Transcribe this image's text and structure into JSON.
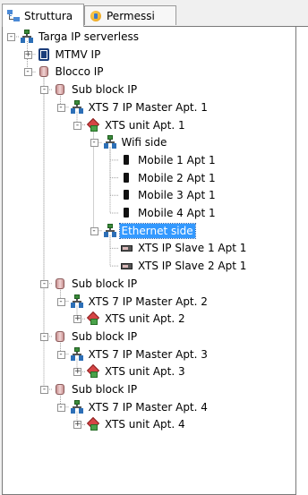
{
  "tabs": [
    {
      "label": "Struttura",
      "icon": "structure-icon",
      "active": true
    },
    {
      "label": "Permessi",
      "icon": "permissions-icon",
      "active": false
    }
  ],
  "tree": {
    "selected_color": "#3399ff",
    "nodes": [
      {
        "label": "Targa IP serverless",
        "icon": "network-icon",
        "level": 0,
        "toggle": "-"
      },
      {
        "label": "MTMV IP",
        "icon": "mtmv-icon",
        "level": 1,
        "toggle": "+"
      },
      {
        "label": "Blocco IP",
        "icon": "block-icon",
        "level": 1,
        "toggle": "-"
      },
      {
        "label": "Sub block IP",
        "icon": "block-icon",
        "level": 2,
        "toggle": "-"
      },
      {
        "label": "XTS 7 IP Master Apt. 1",
        "icon": "network-icon",
        "level": 3,
        "toggle": "-"
      },
      {
        "label": "XTS unit Apt. 1",
        "icon": "unit-icon",
        "level": 4,
        "toggle": "-"
      },
      {
        "label": "Wifi side",
        "icon": "network-icon",
        "level": 5,
        "toggle": "-"
      },
      {
        "label": "Mobile 1 Apt 1",
        "icon": "mobile-icon",
        "level": 6,
        "toggle": ""
      },
      {
        "label": "Mobile 2 Apt 1",
        "icon": "mobile-icon",
        "level": 6,
        "toggle": ""
      },
      {
        "label": "Mobile 3 Apt 1",
        "icon": "mobile-icon",
        "level": 6,
        "toggle": ""
      },
      {
        "label": "Mobile 4 Apt 1",
        "icon": "mobile-icon",
        "level": 6,
        "toggle": ""
      },
      {
        "label": "Ethernet side",
        "icon": "network-icon",
        "level": 5,
        "toggle": "-",
        "selected": true
      },
      {
        "label": "XTS IP Slave 1 Apt 1",
        "icon": "slave-icon",
        "level": 6,
        "toggle": ""
      },
      {
        "label": "XTS IP Slave 2 Apt 1",
        "icon": "slave-icon",
        "level": 6,
        "toggle": ""
      },
      {
        "label": "Sub block IP",
        "icon": "block-icon",
        "level": 2,
        "toggle": "-"
      },
      {
        "label": "XTS 7 IP Master Apt. 2",
        "icon": "network-icon",
        "level": 3,
        "toggle": "-"
      },
      {
        "label": "XTS unit Apt. 2",
        "icon": "unit-icon",
        "level": 4,
        "toggle": "+"
      },
      {
        "label": "Sub block IP",
        "icon": "block-icon",
        "level": 2,
        "toggle": "-"
      },
      {
        "label": "XTS 7 IP Master Apt. 3",
        "icon": "network-icon",
        "level": 3,
        "toggle": "-"
      },
      {
        "label": "XTS unit Apt. 3",
        "icon": "unit-icon",
        "level": 4,
        "toggle": "+"
      },
      {
        "label": "Sub block IP",
        "icon": "block-icon",
        "level": 2,
        "toggle": "-"
      },
      {
        "label": "XTS 7 IP Master Apt. 4",
        "icon": "network-icon",
        "level": 3,
        "toggle": "-"
      },
      {
        "label": "XTS unit Apt. 4",
        "icon": "unit-icon",
        "level": 4,
        "toggle": "+"
      }
    ]
  }
}
